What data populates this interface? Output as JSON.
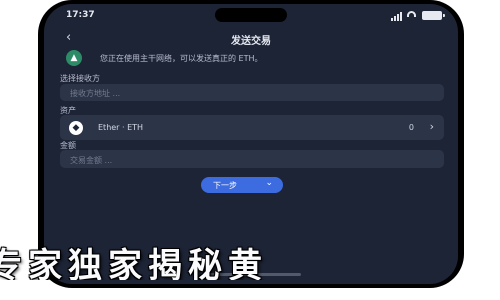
{
  "status_bar": {
    "time": "17:37"
  },
  "header": {
    "back_icon": "‹",
    "title": "发送交易"
  },
  "notice": {
    "icon": "ethereum-icon",
    "text": "您正在使用主干网络，可以发送真正的 ETH。"
  },
  "recipient": {
    "label": "选择接收方",
    "placeholder": "接收方地址 ..."
  },
  "asset": {
    "label": "资产",
    "name": "Ether · ETH",
    "balance": "0",
    "logo_glyph": "◆",
    "chevron": "›"
  },
  "amount": {
    "label": "金额",
    "placeholder": "交易金额 ..."
  },
  "next_button": {
    "label": "下一步",
    "chevron": "⌄"
  },
  "overlay_banner": {
    "text": "专家独家揭秘黄"
  },
  "colors": {
    "accent": "#3c6ce0",
    "screen_bg": "#1d2436",
    "field_bg": "#2c3448",
    "notice_icon": "#2e8b67"
  }
}
